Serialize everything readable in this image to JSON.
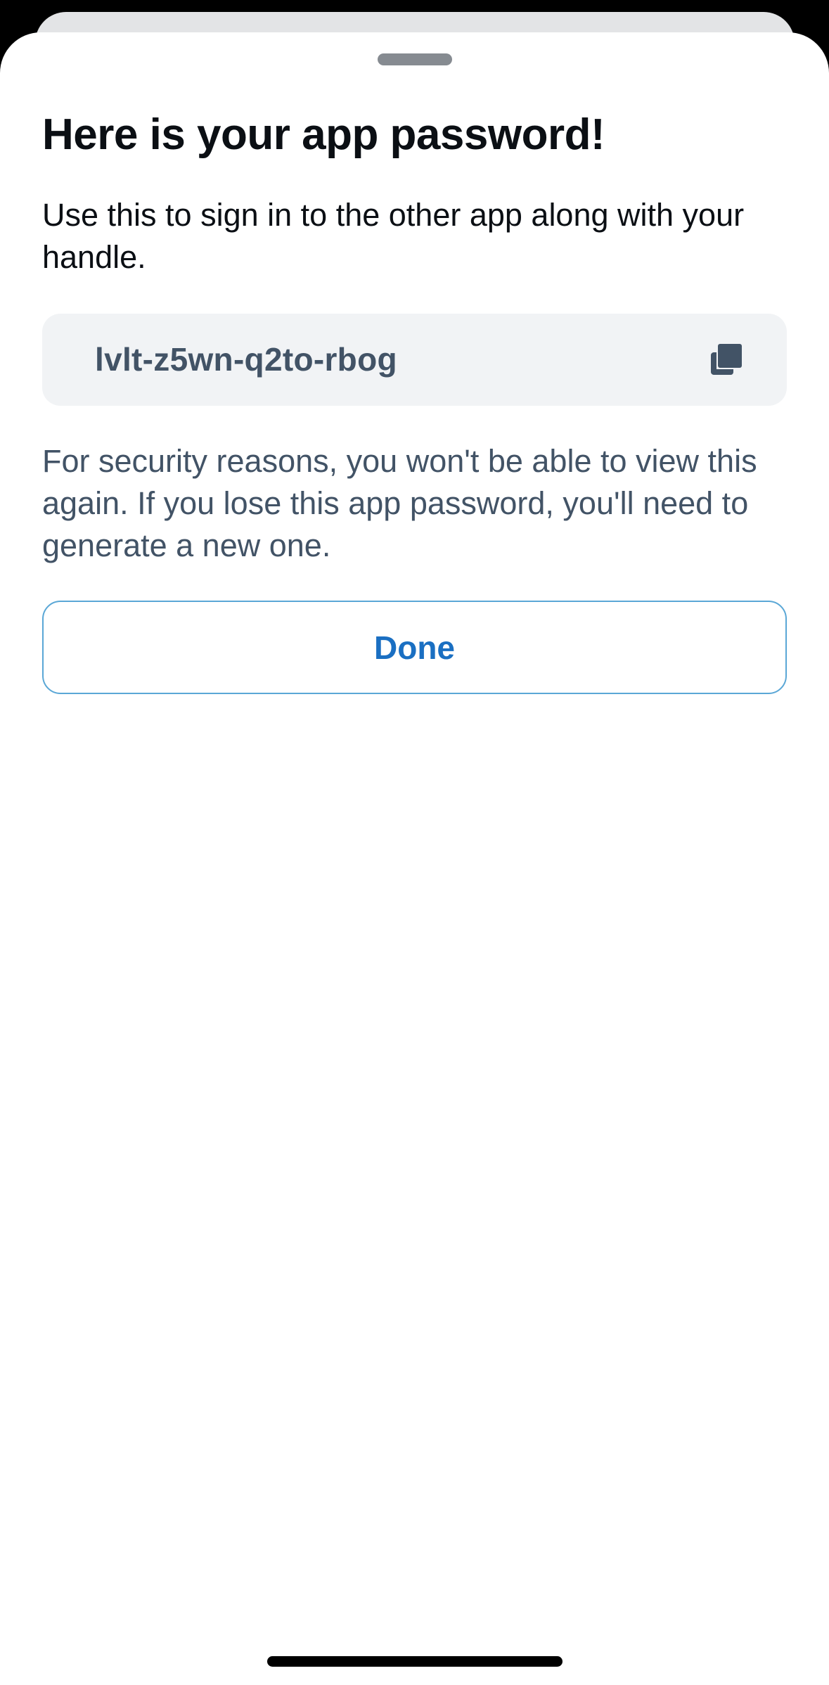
{
  "sheet": {
    "title": "Here is your app password!",
    "subtitle": "Use this to sign in to the other app along with your handle.",
    "password": "lvlt-z5wn-q2to-rbog",
    "copy_icon": "copy-icon",
    "notice": "For security reasons, you won't be able to view this again. If you lose this app password, you'll need to generate a new one.",
    "done_label": "Done"
  },
  "colors": {
    "accent": "#1a6fc2",
    "muted_text": "#425366",
    "field_bg": "#f1f3f5"
  }
}
